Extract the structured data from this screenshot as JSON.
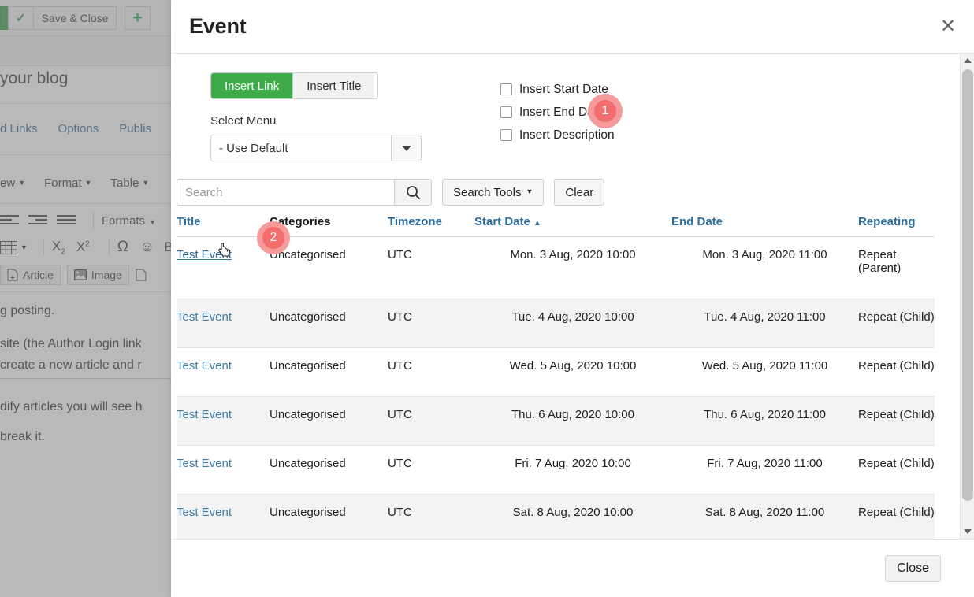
{
  "background": {
    "toolbar": {
      "save_close_label": "Save & Close",
      "check_icon": "check-icon",
      "plus_icon": "plus-icon"
    },
    "blog_title_fragment": "your blog",
    "tabs": [
      "d Links",
      "Options",
      "Publis"
    ],
    "menus": [
      "ew",
      "Format",
      "Table"
    ],
    "formats_label": "Formats",
    "editor_buttons": [
      "Article",
      "Image"
    ],
    "paragraphs": [
      "g posting.",
      "site (the Author Login link",
      "create a new article and r",
      "dify articles you will see h",
      "break it."
    ]
  },
  "modal": {
    "title": "Event",
    "close_icon": "close-icon",
    "close_button_label": "Close",
    "segmented": {
      "active_label": "Insert Link",
      "inactive_label": "Insert Title"
    },
    "select_menu": {
      "label": "Select Menu",
      "value": "- Use Default",
      "arrow_icon": "chevron-down-icon"
    },
    "checkboxes": [
      {
        "label": "Insert Start Date",
        "checked": false
      },
      {
        "label": "Insert End Date",
        "checked": false
      },
      {
        "label": "Insert Description",
        "checked": false
      }
    ],
    "search": {
      "placeholder": "Search",
      "value": "",
      "submit_icon": "search-icon",
      "tools_label": "Search Tools",
      "clear_label": "Clear"
    },
    "table": {
      "columns": [
        {
          "label": "Title",
          "link": true,
          "sorted": false
        },
        {
          "label": "Categories",
          "link": false,
          "sorted": false
        },
        {
          "label": "Timezone",
          "link": true,
          "sorted": false
        },
        {
          "label": "Start Date",
          "link": true,
          "sorted": true,
          "sort_dir": "▲"
        },
        {
          "label": "End Date",
          "link": true,
          "sorted": false
        },
        {
          "label": "Repeating",
          "link": true,
          "sorted": false
        }
      ],
      "rows": [
        {
          "title": "Test Event",
          "categories": "Uncategorised",
          "timezone": "UTC",
          "start": "Mon. 3 Aug, 2020 10:00",
          "end": "Mon. 3 Aug, 2020 11:00",
          "repeating": "Repeat (Parent)",
          "hover": true
        },
        {
          "title": "Test Event",
          "categories": "Uncategorised",
          "timezone": "UTC",
          "start": "Tue. 4 Aug, 2020 10:00",
          "end": "Tue. 4 Aug, 2020 11:00",
          "repeating": "Repeat (Child)",
          "hover": false
        },
        {
          "title": "Test Event",
          "categories": "Uncategorised",
          "timezone": "UTC",
          "start": "Wed. 5 Aug, 2020 10:00",
          "end": "Wed. 5 Aug, 2020 11:00",
          "repeating": "Repeat (Child)",
          "hover": false
        },
        {
          "title": "Test Event",
          "categories": "Uncategorised",
          "timezone": "UTC",
          "start": "Thu. 6 Aug, 2020 10:00",
          "end": "Thu. 6 Aug, 2020 11:00",
          "repeating": "Repeat (Child)",
          "hover": false
        },
        {
          "title": "Test Event",
          "categories": "Uncategorised",
          "timezone": "UTC",
          "start": "Fri. 7 Aug, 2020 10:00",
          "end": "Fri. 7 Aug, 2020 11:00",
          "repeating": "Repeat (Child)",
          "hover": false
        },
        {
          "title": "Test Event",
          "categories": "Uncategorised",
          "timezone": "UTC",
          "start": "Sat. 8 Aug, 2020 10:00",
          "end": "Sat. 8 Aug, 2020 11:00",
          "repeating": "Repeat (Child)",
          "hover": false
        }
      ]
    }
  },
  "annotations": [
    {
      "number": "1"
    },
    {
      "number": "2"
    }
  ],
  "colors": {
    "accent_green": "#3faa4a",
    "link_blue": "#3d7ea6",
    "header_blue": "#2b6d9e",
    "badge_ring": "#f79a9a",
    "badge_core": "#f26d6d",
    "row_alt": "#f3f3f3"
  }
}
